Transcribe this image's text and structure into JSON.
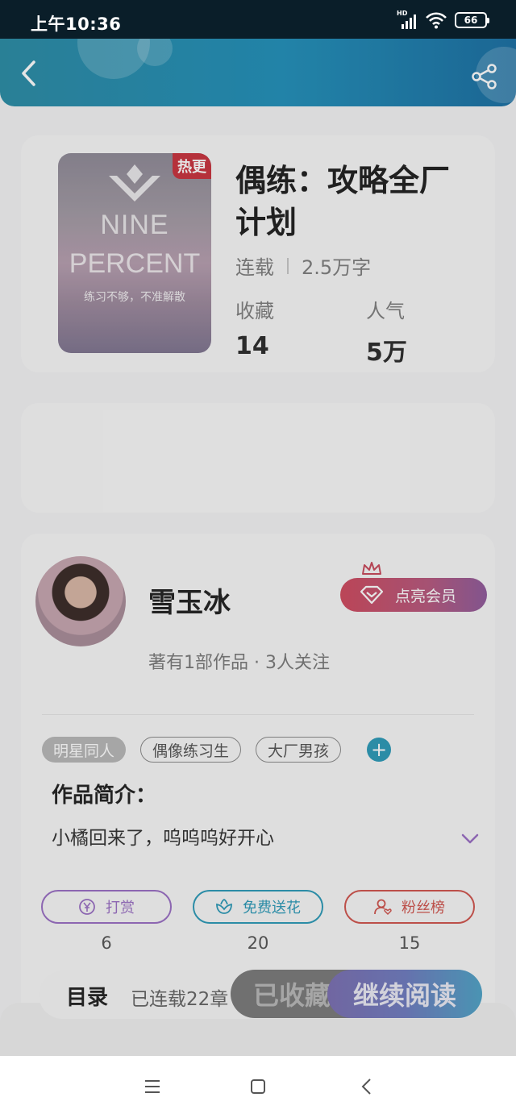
{
  "status_bar": {
    "time": "上午10:36",
    "network": "HD",
    "battery": "66"
  },
  "book": {
    "title": "偶练：攻略全厂计划",
    "cover": {
      "hot_badge": "热更",
      "line1": "NINE",
      "line2": "PERCENT",
      "slogan": "练习不够，不准解散"
    },
    "status": "连载",
    "word_count": "2.5万字",
    "stats": [
      {
        "label": "收藏",
        "value": "14"
      },
      {
        "label": "人气",
        "value": "5万"
      }
    ]
  },
  "author": {
    "name": "雪玉冰",
    "meta": "著有1部作品 · 3人关注",
    "vip_button": "点亮会员"
  },
  "tags": [
    "明星同人",
    "偶像练习生",
    "大厂男孩"
  ],
  "intro": {
    "title": "作品简介：",
    "text": "小橘回来了，呜呜呜好开心"
  },
  "actions": [
    {
      "label": "打赏",
      "count": "6",
      "color": "#9a6fc4"
    },
    {
      "label": "免费送花",
      "count": "20",
      "color": "#2c9ab8"
    },
    {
      "label": "粉丝榜",
      "count": "15",
      "color": "#d1554e"
    }
  ],
  "bottom_bar": {
    "toc_label": "目录",
    "toc_count": "已连载22章",
    "fav_label": "已收藏",
    "read_label": "继续阅读"
  }
}
